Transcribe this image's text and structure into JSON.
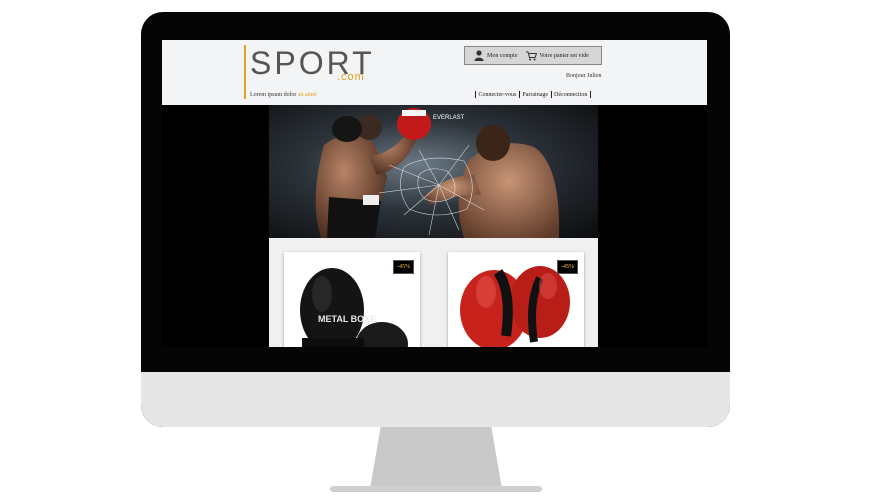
{
  "header": {
    "logo_main": "SPORT",
    "logo_suffix": ".com",
    "tagline_prefix": "Lorem ipsum dolor",
    "tagline_accent": "sit amet",
    "account_label": "Mon compte",
    "cart_label": "Votre panier est vide",
    "greeting": "Bonjour Julien",
    "nav_items": [
      "Connecter-vous",
      "Parrainage",
      "Déconnection"
    ]
  },
  "products": [
    {
      "badge": "-45%",
      "image": "black-boxing-gloves",
      "print": "METAL BOXE"
    },
    {
      "badge": "-45%",
      "image": "red-boxing-gloves"
    }
  ],
  "hero": {
    "image": "boxers-punch-glass-shatter",
    "glove_brand": "EVERLAST"
  },
  "colors": {
    "accent": "#e0a020",
    "header_bg": "#f3f4f6",
    "badge_text": "#f5c542"
  }
}
